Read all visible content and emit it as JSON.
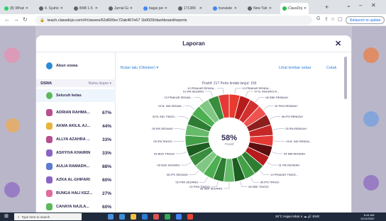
{
  "browser": {
    "tabs": [
      {
        "label": "(8) Whats",
        "color": "#25d366"
      },
      {
        "label": "4. Syahid",
        "color": "#5f6368"
      },
      {
        "label": "BAB 1-5 (",
        "color": "#5f6368"
      },
      {
        "label": "Jurnal Gu",
        "color": "#5f6368"
      },
      {
        "label": "bagai peu",
        "color": "#4285f4"
      },
      {
        "label": "171389",
        "color": "#5f6368"
      },
      {
        "label": "translate",
        "color": "#4285f4"
      },
      {
        "label": "New Tab",
        "color": "#5f6368"
      },
      {
        "label": "ClassDoj",
        "color": "#24c04b"
      }
    ],
    "new_tab": "+",
    "url": "teach.classdojo.com/#/classes/62d600ec72ab467e67 1b0029/dashboard/reports",
    "relaunch_label": "Relaunch to update"
  },
  "modal": {
    "title": "Laporan",
    "close": "✕"
  },
  "sidebar": {
    "top_items": [
      {
        "name": "Akun siswa",
        "icon": "student-account-icon"
      }
    ],
    "section_header": "SISWA",
    "sort_label": "Nama depan ▾",
    "whole_class": "Seluruh kelas",
    "students": [
      {
        "name": "ADRIAN RAHMA...",
        "pct": "67%",
        "color": "#b84e8f"
      },
      {
        "name": "AKMA AKILIL AJ...",
        "pct": "44%",
        "color": "#e9b33d"
      },
      {
        "name": "ALLYA AZAHRA ...",
        "pct": "33%",
        "color": "#b84e8f"
      },
      {
        "name": "ASHYIVA KHAIRIN",
        "pct": "33%",
        "color": "#8a64c2"
      },
      {
        "name": "AULIA RAMADH...",
        "pct": "88%",
        "color": "#5f7bd1"
      },
      {
        "name": "AZKA AL-GHIFARI",
        "pct": "60%",
        "color": "#8a64c2"
      },
      {
        "name": "BUNGA HALI KEZ...",
        "pct": "27%",
        "color": "#e06d9b"
      },
      {
        "name": "CAHAYA NAJLA...",
        "pct": "60%",
        "color": "#5cb85c"
      }
    ]
  },
  "report": {
    "period": "Bulan lalu (Oktober) ▾",
    "view_sheet": "Lihat lembar sebar",
    "print": "Cetak",
    "summary": "Positif: 217   Perlu tindak lanjut: 156",
    "center_pct": "58%",
    "center_label": "Positif"
  },
  "chart_data": {
    "type": "pie",
    "title": "",
    "center_value": "58%",
    "center_label": "Positif",
    "slices": [
      {
        "label": "13 PRAKAR RENDA...",
        "color": "#e63b2e",
        "group": "perlu"
      },
      {
        "label": "07 B. INGGRIS R...",
        "color": "#b71c1c",
        "group": "perlu"
      },
      {
        "label": "08 SBK RENDAH",
        "color": "#d32f2f",
        "group": "perlu"
      },
      {
        "label": "02 PKN RENDAH",
        "color": "#ef5350",
        "group": "perlu"
      },
      {
        "label": "06 IPS RENDAH",
        "color": "#8e1f1f",
        "group": "perlu"
      },
      {
        "label": "05 IPA RENDAH",
        "color": "#c62828",
        "group": "perlu"
      },
      {
        "label": "03 B. IND RENDA...",
        "color": "#e53935",
        "group": "perlu"
      },
      {
        "label": "04 MM RENDAH",
        "color": "#5d0f0f",
        "group": "perlu"
      },
      {
        "label": "01 PAI RENDAH",
        "color": "#b71c1c",
        "group": "perlu"
      },
      {
        "label": "13 PRAKAR TINGG...",
        "color": "#2e7d32",
        "group": "positif"
      },
      {
        "label": "06 IPS TINGGI",
        "color": "#43a047",
        "group": "positif"
      },
      {
        "label": "08 SBK TINGGI",
        "color": "#1b5e20",
        "group": "positif"
      },
      {
        "label": "08 SBK SEDANG",
        "color": "#66bb6a",
        "group": "positif"
      },
      {
        "label": "02 PKN TINGGI",
        "color": "#2e7d32",
        "group": "positif"
      },
      {
        "label": "02 PKN SEDANG",
        "color": "#4caf50",
        "group": "positif"
      },
      {
        "label": "06 IPS SEDANG",
        "color": "#81c784",
        "group": "positif"
      },
      {
        "label": "09 BGK SEDANG",
        "color": "#388e3c",
        "group": "positif"
      },
      {
        "label": "09 BGK TINGGI",
        "color": "#1b5e20",
        "group": "positif"
      },
      {
        "label": "05 IPA TINGGI",
        "color": "#43a047",
        "group": "positif"
      },
      {
        "label": "05 IPA SEDANG",
        "color": "#66bb6a",
        "group": "positif"
      },
      {
        "label": "03 B. IND TINGG...",
        "color": "#2e7d32",
        "group": "positif"
      },
      {
        "label": "03 B. IND SEDAN...",
        "color": "#4caf50",
        "group": "positif"
      },
      {
        "label": "13 PRAKAR SEDAN...",
        "color": "#81c784",
        "group": "positif"
      },
      {
        "label": "01 IPA SEDANG",
        "color": "#388e3c",
        "group": "positif"
      },
      {
        "label": "10 PRAKAR RENDA...",
        "color": "#e53935",
        "group": "perlu"
      }
    ]
  },
  "taskbar": {
    "search_placeholder": "Type here to search",
    "tray": "26°C  Hujan lebat  ∧  ☁ 🔊 ENG",
    "time": "8:44 AM",
    "date": "11/11/2022"
  }
}
